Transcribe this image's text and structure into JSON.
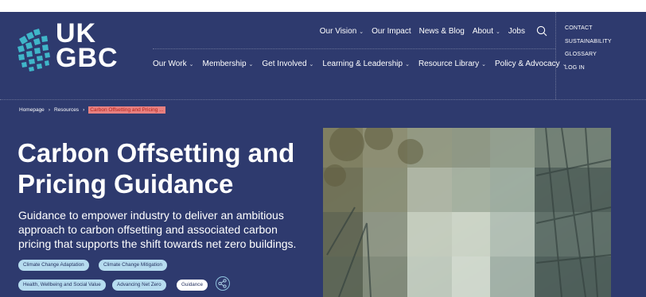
{
  "logo": {
    "line1": "UK",
    "line2": "GBC"
  },
  "topnav": {
    "items": [
      {
        "label": "Our Vision",
        "chevron": true
      },
      {
        "label": "Our Impact",
        "chevron": false
      },
      {
        "label": "News & Blog",
        "chevron": false
      },
      {
        "label": "About",
        "chevron": true
      },
      {
        "label": "Jobs",
        "chevron": false
      }
    ],
    "search_icon": "search-icon"
  },
  "mainnav": {
    "items": [
      {
        "label": "Our Work"
      },
      {
        "label": "Membership"
      },
      {
        "label": "Get Involved"
      },
      {
        "label": "Learning & Leadership"
      },
      {
        "label": "Resource Library"
      },
      {
        "label": "Policy & Advocacy"
      }
    ]
  },
  "sidelinks": [
    "CONTACT",
    "SUSTAINABILITY",
    "GLOSSARY",
    "LOG IN"
  ],
  "breadcrumb": {
    "items": [
      "Homepage",
      "Resources"
    ],
    "current": "Carbon Offsetting and Pricing ..."
  },
  "hero": {
    "title": "Carbon Offsetting and Pricing Guidance",
    "lead": "Guidance to empower industry to deliver an ambitious approach to carbon offsetting and associated carbon pricing that supports the shift towards net zero buildings.",
    "tags": [
      "Climate Change Adaptation",
      "Climate Change Mitigation",
      "Health, Wellbeing and Social Value",
      "Advancing Net Zero",
      "Guidance"
    ]
  },
  "colors": {
    "page_bg": "#2e3a6e",
    "tag_bg": "#b6dcef",
    "logo_teal": "#3fb6c9",
    "breadcrumb_highlight": "#e88080"
  }
}
